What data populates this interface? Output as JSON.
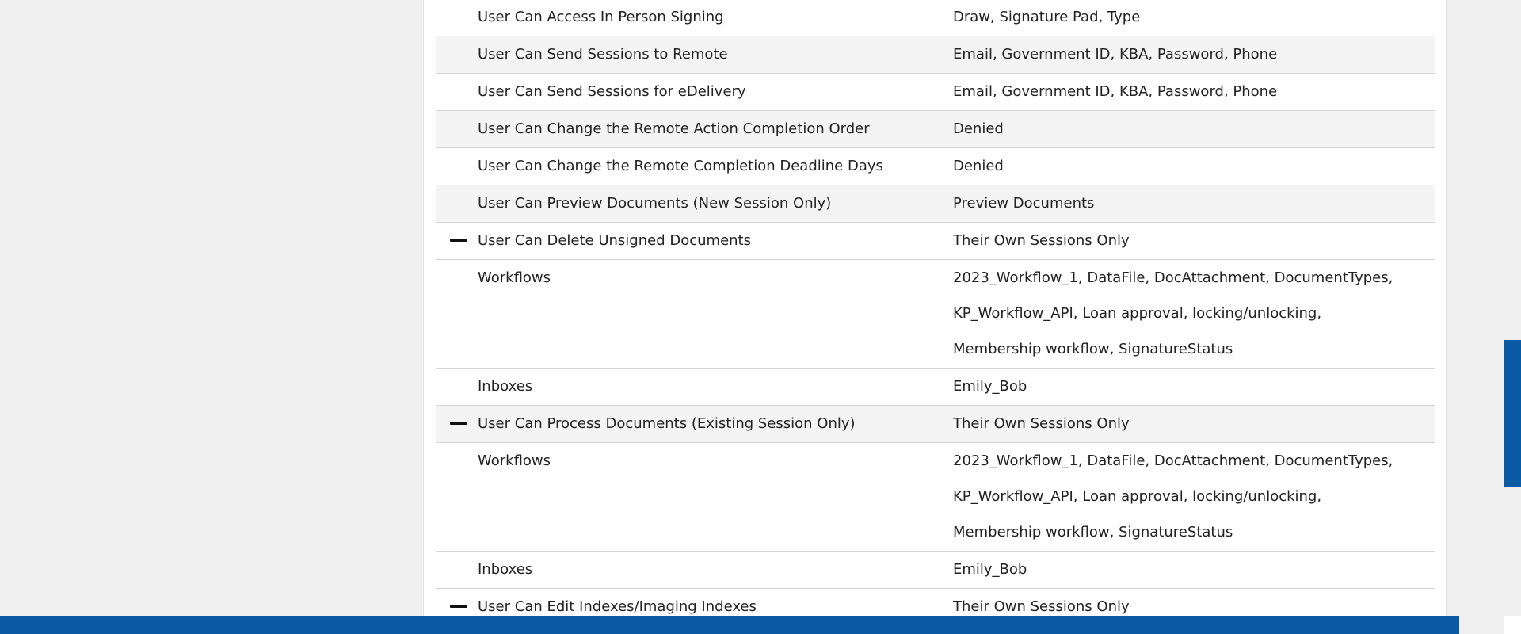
{
  "permissions": {
    "rows": [
      {
        "label": "User Can Access In Person Signing",
        "value": "Draw, Signature Pad, Type"
      },
      {
        "label": "User Can Send Sessions to Remote",
        "value": "Email, Government ID, KBA, Password, Phone"
      },
      {
        "label": "User Can Send Sessions for eDelivery",
        "value": "Email, Government ID, KBA, Password, Phone"
      },
      {
        "label": "User Can Change the Remote Action Completion Order",
        "value": "Denied"
      },
      {
        "label": "User Can Change the Remote Completion Deadline Days",
        "value": "Denied"
      },
      {
        "label": "User Can Preview Documents (New Session Only)",
        "value": "Preview Documents"
      },
      {
        "label": "User Can Delete Unsigned Documents",
        "value": "Their Own Sessions Only"
      },
      {
        "label": "Workflows",
        "value": "2023_Workflow_1, DataFile, DocAttachment, DocumentTypes, KP_Workflow_API, Loan approval, locking/unlocking, Membership workflow, SignatureStatus"
      },
      {
        "label": "Inboxes",
        "value": "Emily_Bob"
      },
      {
        "label": "User Can Process Documents (Existing Session Only)",
        "value": "Their Own Sessions Only"
      },
      {
        "label": "Workflows",
        "value": "2023_Workflow_1, DataFile, DocAttachment, DocumentTypes, KP_Workflow_API, Loan approval, locking/unlocking, Membership workflow, SignatureStatus"
      },
      {
        "label": "Inboxes",
        "value": "Emily_Bob"
      },
      {
        "label": "User Can Edit Indexes/Imaging Indexes",
        "value": "Their Own Sessions Only"
      }
    ]
  },
  "icons": {
    "collapse": "minus-icon"
  },
  "colors": {
    "accent": "#0a5aa5",
    "row_alt": "#f4f4f4",
    "border": "#d4d4d4",
    "background": "#f0f0f0"
  }
}
